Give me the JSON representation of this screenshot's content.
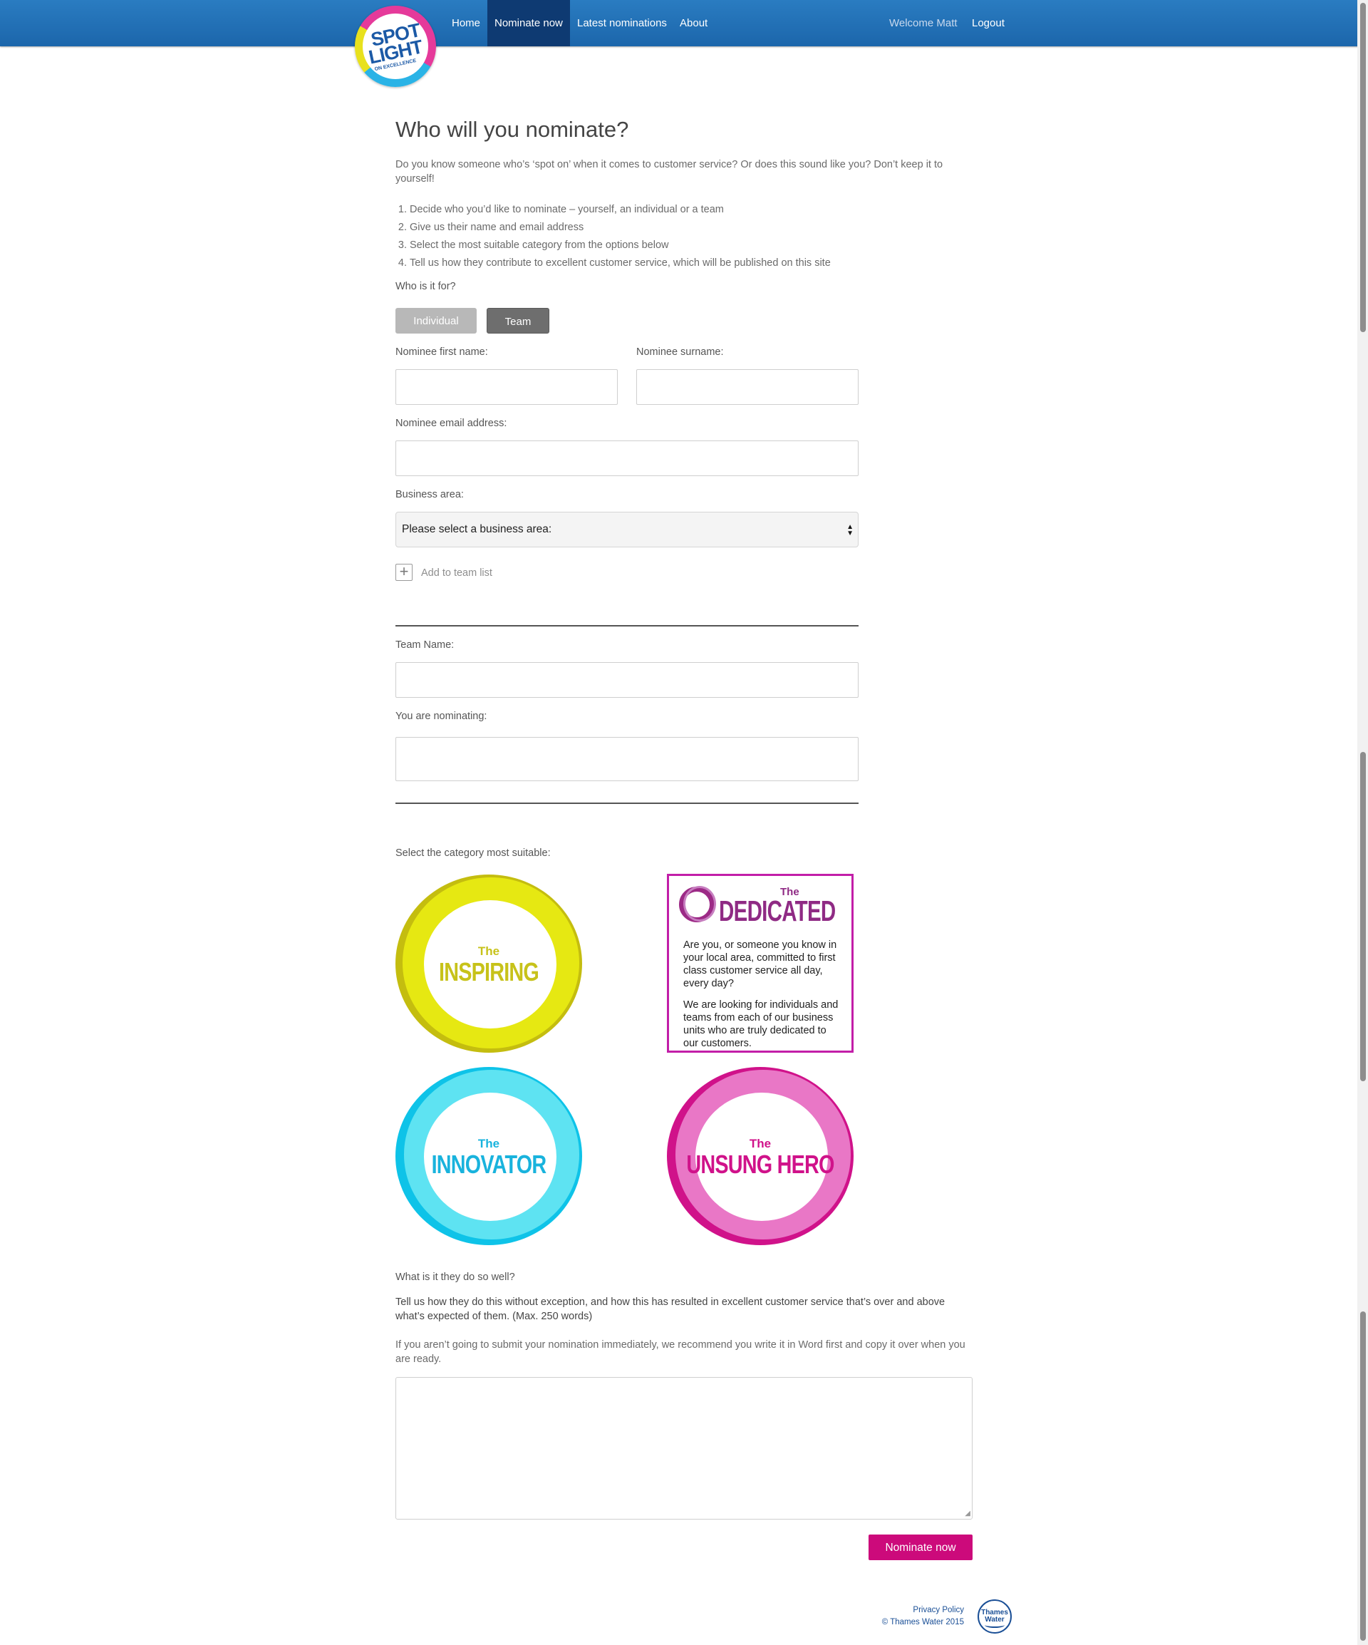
{
  "header": {
    "logo": {
      "line1": "SPOT",
      "line2": "LIGHT",
      "line3": "ON EXCELLENCE"
    },
    "nav": {
      "home": "Home",
      "nominate": "Nominate now",
      "latest": "Latest nominations",
      "about": "About"
    },
    "welcome": "Welcome Matt",
    "logout": "Logout"
  },
  "page": {
    "title": "Who will you nominate?",
    "intro": "Do you know someone who’s ‘spot on’ when it comes to customer service? Or does this sound like you? Don’t keep it to yourself!",
    "steps": [
      "Decide who you’d like to nominate – yourself, an individual or a team",
      "Give us their name and email address",
      "Select the most suitable category from the options below",
      "Tell us how they contribute to excellent customer service, which will be published on this site"
    ]
  },
  "form": {
    "who_label": "Who is it for?",
    "individual_label": "Individual",
    "team_label": "Team",
    "first_name_label": "Nominee first name:",
    "first_name_value": "",
    "surname_label": "Nominee surname:",
    "surname_value": "",
    "email_label": "Nominee email address:",
    "email_value": "",
    "business_area_label": "Business area:",
    "business_area_selected": "Please select a business area:",
    "add_team_label": "Add to team list",
    "team_name_label": "Team Name:",
    "team_name_value": "",
    "nominating_label": "You are nominating:",
    "category_label": "Select the category most suitable:",
    "what_label": "What is it they do so well?",
    "what_help": "Tell us how they do this without exception, and how this has resulted in excellent customer service that’s over and above what’s expected of them. (Max. 250 words)",
    "word_tip": "If you aren’t going to submit your nomination immediately, we recommend you write it in Word first and copy it over when you are ready.",
    "description_value": "",
    "submit_label": "Nominate now"
  },
  "categories": {
    "inspiring": {
      "the": "The",
      "name": "INSPIRING",
      "color": "#c7c21a"
    },
    "dedicated": {
      "the": "The",
      "name": "DEDICATED",
      "color": "#8f2a84",
      "text1": "Are you, or someone you know in your local area, committed to first class customer service all day, every day?",
      "text2": "We are looking for individuals and teams from each of our business units who are truly dedicated to our customers."
    },
    "innovator": {
      "the": "The",
      "name": "INNOVATOR",
      "color": "#19b3dd"
    },
    "unsung_hero": {
      "the": "The",
      "name": "UNSUNG HERO",
      "color": "#d0128a"
    }
  },
  "footer": {
    "privacy": "Privacy Policy",
    "copyright": "© Thames Water 2015",
    "logo_line1": "Thames",
    "logo_line2": "Water"
  },
  "colors": {
    "nav_bar": "#1f6db3",
    "nav_active": "#0e3a72",
    "accent": "#cc0a7b"
  }
}
